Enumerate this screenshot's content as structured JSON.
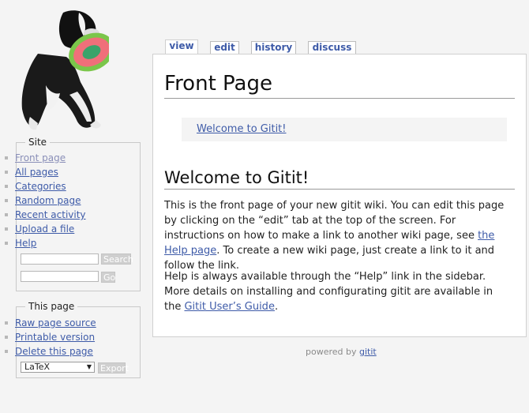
{
  "sidebar": {
    "site_legend": "Site",
    "site_links": [
      "Front page",
      "All pages",
      "Categories",
      "Random page",
      "Recent activity",
      "Upload a file",
      "Help"
    ],
    "search_button": "Search",
    "go_button": "Go",
    "search_input_value": "",
    "go_input_value": "",
    "thispage_legend": "This page",
    "thispage_links": [
      "Raw page source",
      "Printable version",
      "Delete this page"
    ],
    "export_format_selected": "LaTeX",
    "export_button": "Export"
  },
  "tabs": [
    "view",
    "edit",
    "history",
    "discuss"
  ],
  "content": {
    "title": "Front Page",
    "toc_link": "Welcome to Gitit!",
    "section_title": "Welcome to Gitit!",
    "para1": {
      "before": "This is the front page of your new gitit wiki. You can edit this page by clicking on the “edit” tab at the top of the screen. For instructions on how to make a link to another wiki page, see ",
      "link": "the Help page",
      "after": ". To create a new wiki page, just create a link to it and follow the link."
    },
    "para2": {
      "before": "Help is always available through the “Help” link in the sidebar. More details on installing and configurating gitit are available in the ",
      "link": "Gitit User’s Guide",
      "after": "."
    }
  },
  "footer": {
    "text": "powered by ",
    "link": "gitit"
  },
  "colors": {
    "link": "#3e5ba8",
    "visited_link": "#8a8fb8",
    "page_background": "#f4f4f4"
  },
  "icons": {
    "logo": "dog-catching-frisbee-logo"
  }
}
